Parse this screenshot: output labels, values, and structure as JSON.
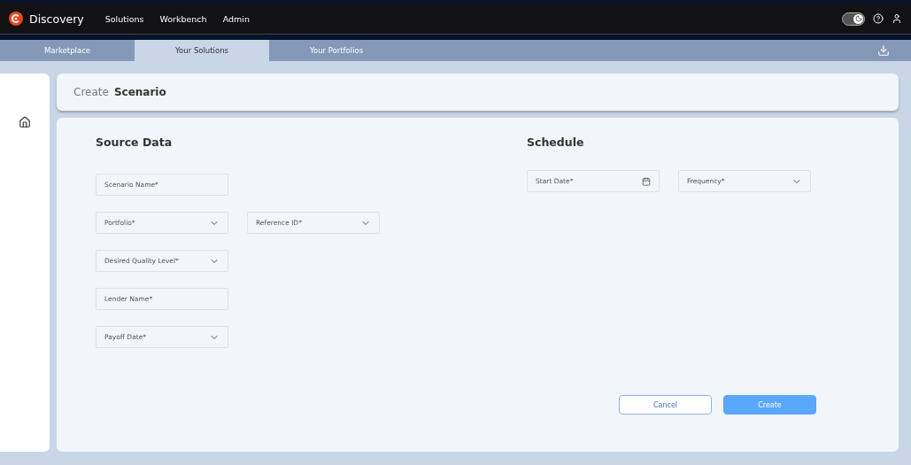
{
  "brand": {
    "name": "Discovery"
  },
  "nav": [
    {
      "label": "Solutions"
    },
    {
      "label": "Workbench"
    },
    {
      "label": "Admin"
    }
  ],
  "theme_toggle": {
    "on": true
  },
  "tabs": [
    {
      "label": "Marketplace",
      "selected": false
    },
    {
      "label": "Your Solutions",
      "selected": true
    },
    {
      "label": "Your Portfolios",
      "selected": false
    }
  ],
  "page_title": {
    "prefix": "Create",
    "name": "Scenario"
  },
  "source_data": {
    "title": "Source Data",
    "rows": [
      [
        {
          "placeholder": "Scenario Name*",
          "kind": "text"
        }
      ],
      [
        {
          "placeholder": "Portfolio*",
          "kind": "select"
        },
        {
          "placeholder": "Reference ID*",
          "kind": "select"
        }
      ],
      [
        {
          "placeholder": "Desired Quality Level*",
          "kind": "select"
        }
      ],
      [
        {
          "placeholder": "Lender Name*",
          "kind": "text"
        }
      ],
      [
        {
          "placeholder": "Payoff Date*",
          "kind": "select"
        }
      ]
    ]
  },
  "schedule": {
    "title": "Schedule",
    "fields": [
      {
        "placeholder": "Start Date*",
        "kind": "date"
      },
      {
        "placeholder": "Frequency*",
        "kind": "select"
      }
    ]
  },
  "buttons": [
    {
      "label": "Cancel",
      "kind": "secondary"
    },
    {
      "label": "Create",
      "kind": "primary"
    }
  ]
}
